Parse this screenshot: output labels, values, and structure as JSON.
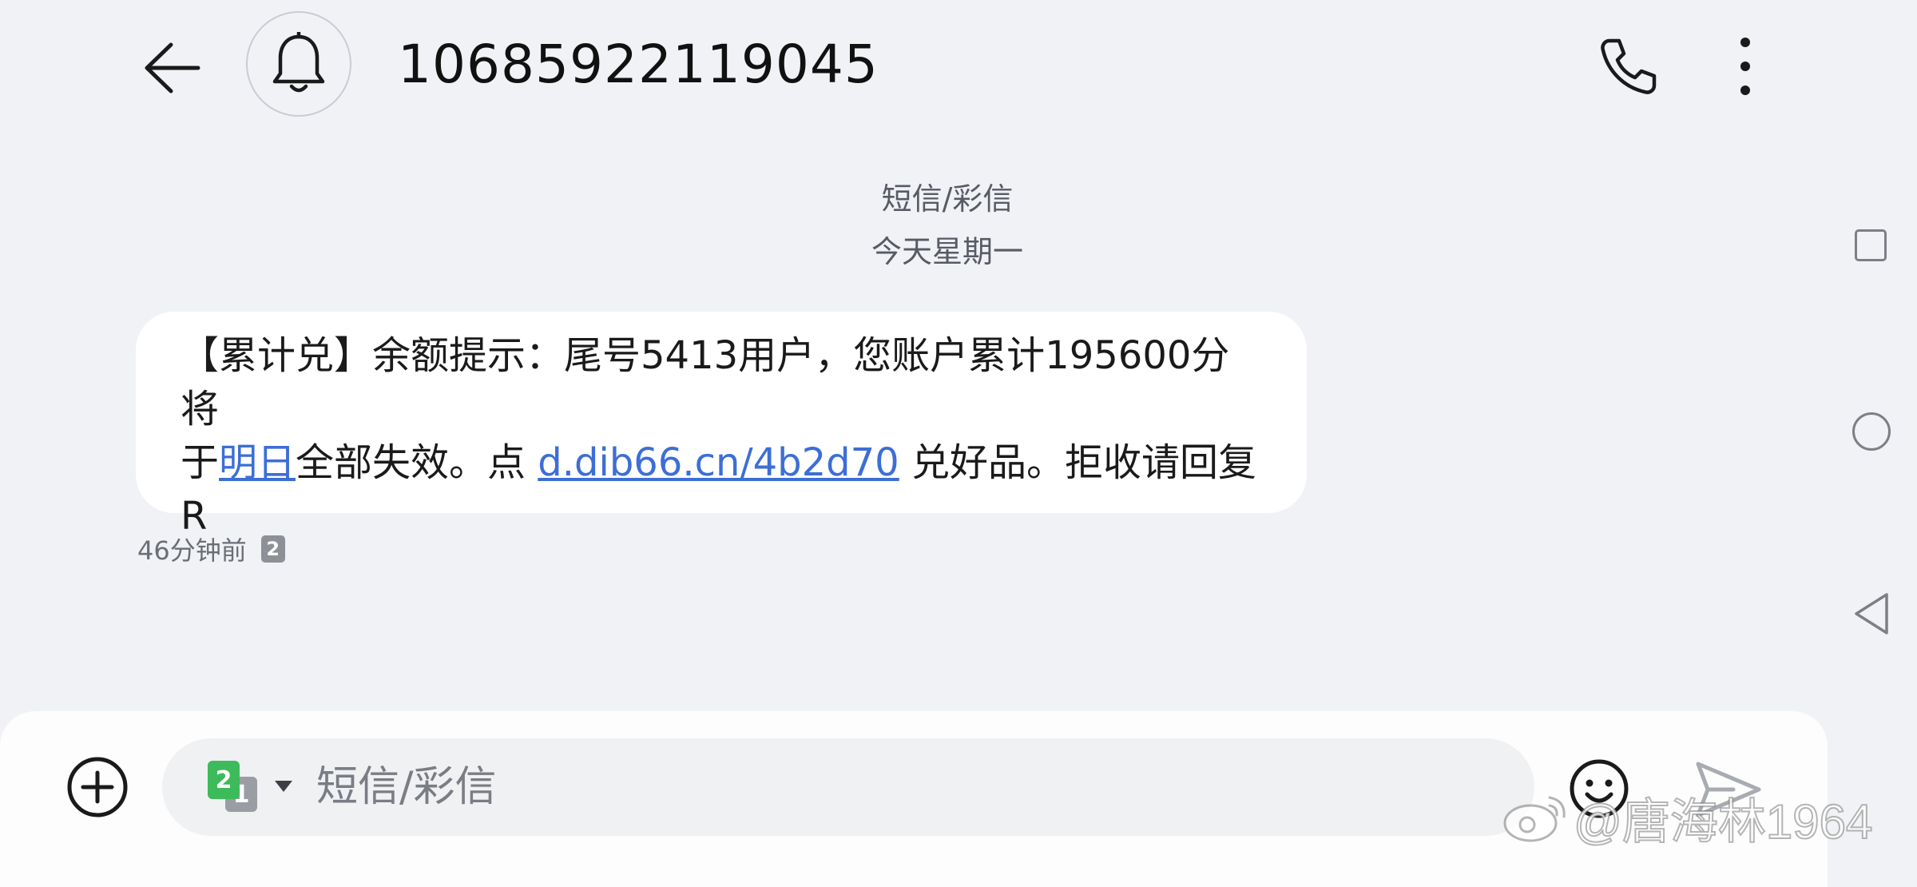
{
  "header": {
    "title": "10685922119045",
    "icons": {
      "back": "arrow-left-icon",
      "bell": "bell-icon",
      "call": "phone-icon",
      "more": "more-vertical-icon"
    }
  },
  "conversation": {
    "channel_label": "短信/彩信",
    "date_label": "今天星期一",
    "message": {
      "line1": "【累计兑】余额提示：尾号5413用户，您账户累计195600分将",
      "line2_prefix": "于",
      "line2_link_date": "明日",
      "line2_mid": "全部失效。点 ",
      "line2_link_url": "d.dib66.cn/4b2d70",
      "line2_suffix": " 兑好品。拒收请回复",
      "line3": "R"
    },
    "time_label": "46分钟前",
    "sim_number": "2"
  },
  "composer": {
    "sim_primary": "2",
    "sim_secondary": "1",
    "placeholder": "短信/彩信",
    "icons": {
      "add": "plus-circle-icon",
      "emoji": "emoji-icon",
      "send": "send-icon"
    }
  },
  "nav": {
    "icons": [
      "recent-apps-icon",
      "home-icon",
      "back-triangle-icon"
    ]
  },
  "watermark": {
    "text": "@唐海林1964"
  },
  "colors": {
    "background": "#f1f2f6",
    "link": "#3d6ed6",
    "sim_green": "#3dbb5a"
  }
}
